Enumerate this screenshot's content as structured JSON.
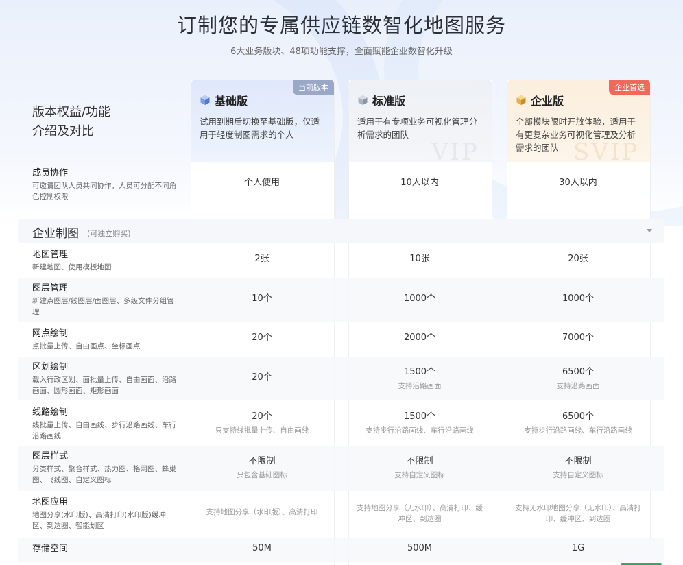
{
  "header": {
    "title": "订制您的专属供应链数智化地图服务",
    "subtitle": "6大业务版块、48项功能支撑，全面赋能企业数智化升级"
  },
  "compare_label": [
    "版本权益/功能",
    "介绍及对比"
  ],
  "plans": [
    {
      "name": "基础版",
      "icon": "cube-icon-blue",
      "badge": "当前版本",
      "desc": "试用到期后切换至基础版，仅适用于轻度制图需求的个人",
      "watermark": ""
    },
    {
      "name": "标准版",
      "icon": "cube-icon-gray",
      "badge": "",
      "desc": "适用于有专项业务可视化管理分析需求的团队",
      "watermark": "VIP"
    },
    {
      "name": "企业版",
      "icon": "cube-icon-gold",
      "badge": "企业首选",
      "desc": "全部模块限时开放体验，适用于有更复杂业务可视化管理及分析需求的团队",
      "watermark": "SVIP"
    }
  ],
  "member_row": {
    "title": "成员协作",
    "desc": "可邀请团队人员共同协作，人员可分配不同角色控制权限",
    "values": [
      "个人使用",
      "10人以内",
      "30人以内"
    ]
  },
  "section": {
    "title": "企业制图",
    "note": "(可独立购买)"
  },
  "rows": [
    {
      "title": "地图管理",
      "desc": "新建地图、使用模板地图",
      "cells": [
        {
          "v": "2张",
          "n": ""
        },
        {
          "v": "10张",
          "n": ""
        },
        {
          "v": "20张",
          "n": ""
        }
      ]
    },
    {
      "title": "图层管理",
      "desc": "新建点图层/线图层/面图层、多级文件分组管理",
      "cells": [
        {
          "v": "10个",
          "n": ""
        },
        {
          "v": "1000个",
          "n": ""
        },
        {
          "v": "1000个",
          "n": ""
        }
      ]
    },
    {
      "title": "网点绘制",
      "desc": "点批量上传、自由画点、坐标画点",
      "cells": [
        {
          "v": "20个",
          "n": ""
        },
        {
          "v": "2000个",
          "n": ""
        },
        {
          "v": "7000个",
          "n": ""
        }
      ]
    },
    {
      "title": "区划绘制",
      "desc": "载入行政区划、面批量上传、自由画面、沿路画面、圆形画面、矩形画面",
      "cells": [
        {
          "v": "20个",
          "n": ""
        },
        {
          "v": "1500个",
          "n": "支持沿路画面"
        },
        {
          "v": "6500个",
          "n": "支持沿路画面"
        }
      ]
    },
    {
      "title": "线路绘制",
      "desc": "线批量上传、自由画线、步行沿路画线、车行沿路画线",
      "cells": [
        {
          "v": "20个",
          "n": "只支持线批量上传、自由画线"
        },
        {
          "v": "1500个",
          "n": "支持步行沿路画线、车行沿路画线"
        },
        {
          "v": "6500个",
          "n": "支持步行沿路画线、车行沿路画线"
        }
      ]
    },
    {
      "title": "图层样式",
      "desc": "分类样式、聚合样式、热力图、格网图、蜂巢图、飞线图、自定义图标",
      "cells": [
        {
          "v": "不限制",
          "n": "只包含基础图标"
        },
        {
          "v": "不限制",
          "n": "支持自定义图标"
        },
        {
          "v": "不限制",
          "n": "支持自定义图标"
        }
      ]
    },
    {
      "title": "地图应用",
      "desc": "地图分享(水印版)、高清打印(水印版)缓冲区、到达圈、智能划区",
      "cells": [
        {
          "v": "",
          "n": "支持地图分享（水印版）、高清打印"
        },
        {
          "v": "",
          "n": "支持地图分享（无水印）、高清打印、缓冲区、到达圈"
        },
        {
          "v": "",
          "n": "支持无水印地图分享（无水印）、高清打印、缓冲区、到达圈"
        }
      ]
    },
    {
      "title": "存储空间",
      "desc": "",
      "cells": [
        {
          "v": "50M",
          "n": ""
        },
        {
          "v": "500M",
          "n": ""
        },
        {
          "v": "1G",
          "n": ""
        }
      ]
    }
  ],
  "colors": {
    "accent_blue": "#5b7fd6",
    "badge_current": "#9aa8c8",
    "badge_enterprise": "#f0695a",
    "gold": "#e0a030"
  }
}
